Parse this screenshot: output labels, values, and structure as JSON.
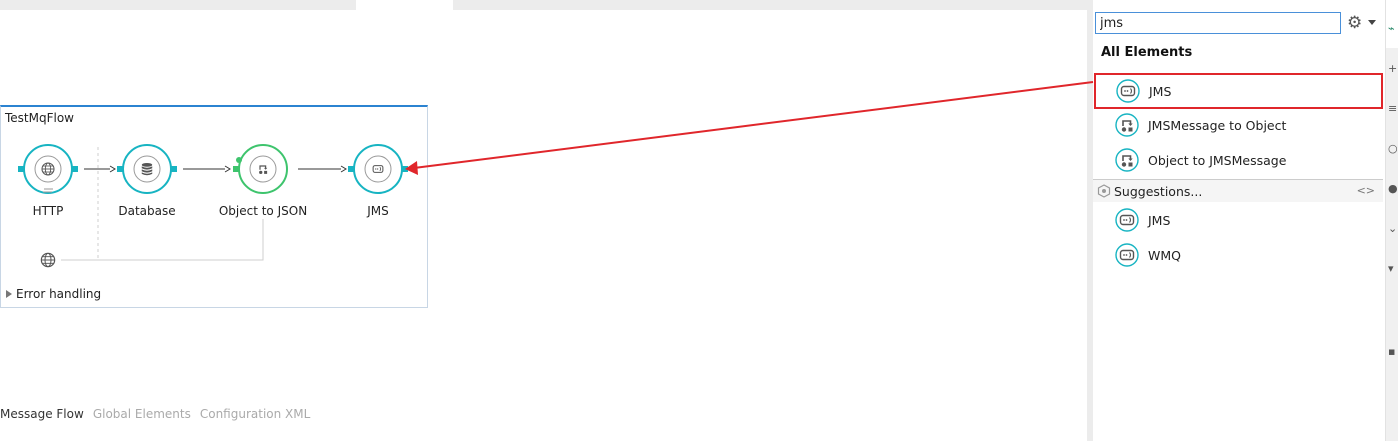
{
  "flow": {
    "title": "TestMqFlow",
    "nodes": [
      {
        "label": "HTTP",
        "icon": "globe-icon"
      },
      {
        "label": "Database",
        "icon": "database-icon"
      },
      {
        "label": "Object to JSON",
        "icon": "transformer-icon"
      },
      {
        "label": "JMS",
        "icon": "jms-connector-icon"
      }
    ],
    "error_handling": "Error handling"
  },
  "bottom_tabs": [
    "Message Flow",
    "Global Elements",
    "Configuration XML"
  ],
  "palette": {
    "search": {
      "value": "jms"
    },
    "all_elements_title": "All Elements",
    "all_elements": [
      {
        "label": "JMS",
        "icon": "jms-connector-icon"
      },
      {
        "label": "JMSMessage to Object",
        "icon": "transformer-icon"
      },
      {
        "label": "Object to JMSMessage",
        "icon": "transformer-icon"
      }
    ],
    "suggestions_title": "Suggestions...",
    "suggestions": [
      {
        "label": "JMS",
        "icon": "jms-connector-icon"
      },
      {
        "label": "WMQ",
        "icon": "wmq-connector-icon"
      }
    ]
  },
  "colors": {
    "connector": "#17b4c2",
    "transformer": "#3ec46d",
    "highlight": "#e0262b",
    "flow_border": "#2b83d1"
  }
}
